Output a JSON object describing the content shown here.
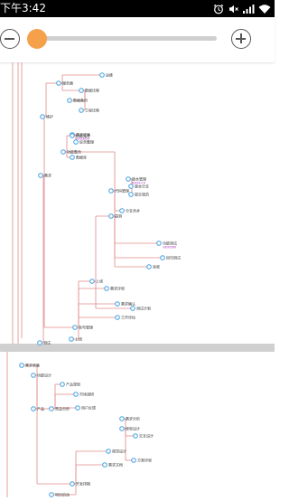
{
  "status_bar": {
    "time": "下午3:42",
    "icons": [
      "alarm-icon",
      "mute-icon",
      "signal-icon",
      "wifi-icon"
    ]
  },
  "zoom": {
    "level": 0.05,
    "accent": "#f5a04b",
    "minus_icon": "zoom-out-icon",
    "plus_icon": "zoom-in-icon"
  },
  "mindmap": {
    "line_color": "#e08a8a",
    "node_color": "#3fa0e0",
    "divider_color": "#d0d0d0",
    "sections": [
      {
        "nodes": [
          {
            "label": "运维",
            "sublabel": ""
          },
          {
            "label": "服务器",
            "sublabel": ""
          },
          {
            "label": "数据迁移",
            "sublabel": ""
          },
          {
            "label": "数据备份",
            "sublabel": ""
          },
          {
            "label": "工程迁移",
            "sublabel": ""
          },
          {
            "label": "维护",
            "sublabel": ""
          },
          {
            "label": "需求收集",
            "sublabel": "需求收集整理"
          },
          {
            "label": "功能设计",
            "sublabel": ""
          },
          {
            "label": "功能整合",
            "sublabel": ""
          },
          {
            "label": "综合整理",
            "sublabel": ""
          },
          {
            "label": "数据库",
            "sublabel": ""
          },
          {
            "label": "版本管理",
            "sublabel": "版本发布计划"
          },
          {
            "label": "代码管理",
            "sublabel": ""
          },
          {
            "label": "版本分支",
            "sublabel": ""
          },
          {
            "label": "提交规范",
            "sublabel": ""
          },
          {
            "label": "分支合并",
            "sublabel": ""
          },
          {
            "label": "提测",
            "sublabel": ""
          },
          {
            "label": "上线",
            "sublabel": ""
          },
          {
            "label": "发布管理",
            "sublabel": ""
          },
          {
            "label": "功能测试",
            "sublabel": "功能测试用例"
          },
          {
            "label": "回归测试",
            "sublabel": ""
          },
          {
            "label": "验收",
            "sublabel": ""
          },
          {
            "label": "测试计划",
            "sublabel": ""
          },
          {
            "label": "需求评审",
            "sublabel": ""
          },
          {
            "label": "需求确认",
            "sublabel": ""
          },
          {
            "label": "工作评估",
            "sublabel": ""
          },
          {
            "label": "需求",
            "sublabel": ""
          },
          {
            "label": "上线",
            "sublabel": ""
          },
          {
            "label": "测试",
            "sublabel": ""
          }
        ]
      },
      {
        "nodes": [
          {
            "label": "需求收集",
            "sublabel": ""
          },
          {
            "label": "功能设计",
            "sublabel": ""
          },
          {
            "label": "产品规划",
            "sublabel": ""
          },
          {
            "label": "市场调研",
            "sublabel": ""
          },
          {
            "label": "竞品分析",
            "sublabel": ""
          },
          {
            "label": "用户反馈",
            "sublabel": ""
          },
          {
            "label": "需求分析",
            "sublabel": ""
          },
          {
            "label": "原型设计",
            "sublabel": ""
          },
          {
            "label": "交互设计",
            "sublabel": ""
          },
          {
            "label": "视觉设计",
            "sublabel": ""
          },
          {
            "label": "方案评审",
            "sublabel": ""
          },
          {
            "label": "需求文档",
            "sublabel": ""
          },
          {
            "label": "开发排期",
            "sublabel": ""
          },
          {
            "label": "产品",
            "sublabel": ""
          },
          {
            "label": "项目启动",
            "sublabel": ""
          }
        ]
      }
    ]
  }
}
